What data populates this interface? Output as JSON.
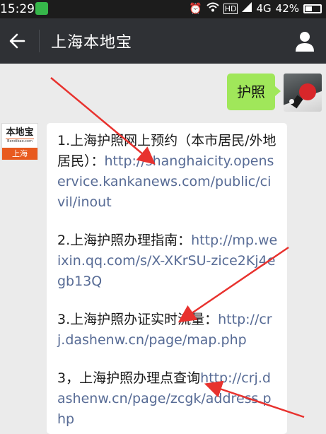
{
  "status_bar": {
    "time": "15:29",
    "signal_label": "4G",
    "battery": "42%",
    "hd_label": "HD"
  },
  "nav": {
    "title": "上海本地宝",
    "back_icon": "arrow-left-icon",
    "profile_icon": "person-icon"
  },
  "messages": {
    "me_text": "护照",
    "bot_avatar": {
      "top": "本地宝",
      "sub": "Bendibao.com",
      "bottom": "上海"
    },
    "items": [
      {
        "text": "1.上海护照网上预约（本市居民/外地居民）：",
        "link": "http://shanghaicity.openservice.kankanews.com/public/civil/inout"
      },
      {
        "text": "2.上海护照办理指南：",
        "link": "http://mp.weixin.qq.com/s/X-XKrSU-zice2Kj4egb13Q"
      },
      {
        "text": "3.上海护照办证实时流量：",
        "link": "http://crj.dashenw.cn/page/map.php"
      },
      {
        "text": "3，上海护照办理点查询",
        "link": "http://crj.dashenw.cn/page/zcgk/address.php"
      }
    ]
  },
  "colors": {
    "nav_bg": "#2f3135",
    "bubble_me": "#a0e75a",
    "link": "#576b95",
    "arrow": "#e8322e",
    "brand": "#e85a1f"
  }
}
